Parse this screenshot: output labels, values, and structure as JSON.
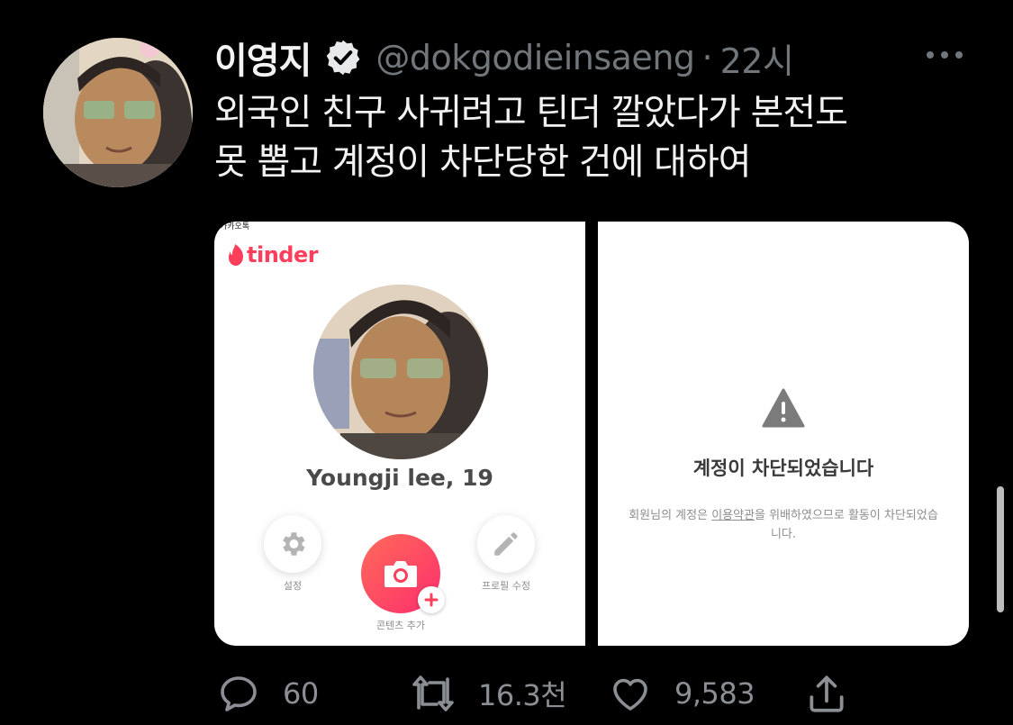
{
  "tweet": {
    "display_name": "이영지",
    "handle": "@dokgodieinsaeng",
    "separator": "·",
    "time": "22시",
    "text": "외국인 친구 사귀려고 틴더 깔았다가 본전도\n못 뽑고 계정이 차단당한 건에 대하여"
  },
  "media": {
    "left": {
      "kakao_label": "카카오톡",
      "logo_text": "tinder",
      "profile_name": "Youngji lee, 19",
      "settings_label": "설정",
      "add_content_label": "콘텐츠 추가",
      "edit_profile_label": "프로필 수정"
    },
    "right": {
      "title": "계정이 차단되었습니다",
      "message_before": "회원님의 계정은 ",
      "terms_link": "이용약관",
      "message_after": "을 위배하였으므로 활동이 차단되었습니다."
    }
  },
  "actions": {
    "replies": "60",
    "retweets": "16.3천",
    "likes": "9,583"
  },
  "icons": [
    "verified-badge-icon",
    "more-icon",
    "tinder-flame-icon",
    "gear-icon",
    "camera-icon",
    "plus-icon",
    "pencil-icon",
    "warning-icon",
    "reply-icon",
    "retweet-icon",
    "like-icon",
    "share-icon"
  ],
  "colors": {
    "background": "#000000",
    "secondary_text": "#71767b",
    "tinder_brand": "#fd3f5b"
  }
}
